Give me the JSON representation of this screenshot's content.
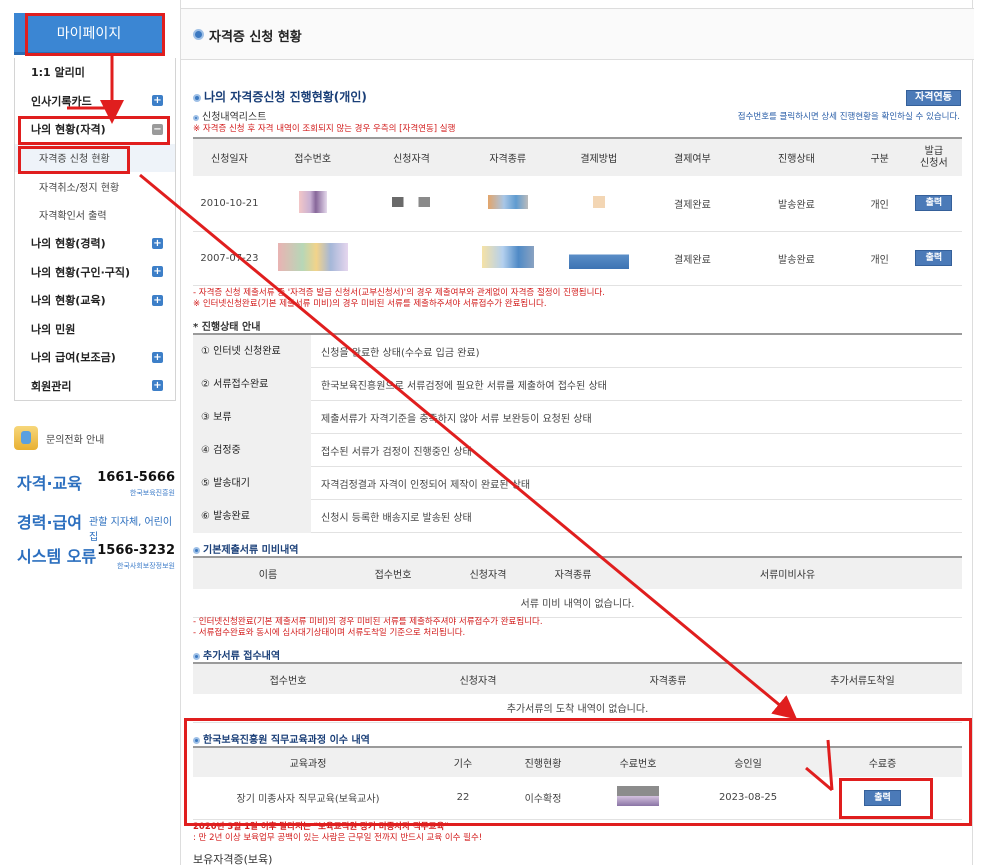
{
  "sidebar": {
    "mypage_label": "마이페이지",
    "items": [
      {
        "label": "1:1 알리미",
        "type": "top",
        "icon": ""
      },
      {
        "label": "인사기록카드",
        "type": "top",
        "icon": "plus"
      },
      {
        "label": "나의 현황(자격)",
        "type": "top",
        "icon": "minus"
      },
      {
        "label": "자격증 신청 현황",
        "type": "sub",
        "icon": ""
      },
      {
        "label": "자격취소/정지 현황",
        "type": "sub",
        "icon": ""
      },
      {
        "label": "자격확인서 출력",
        "type": "sub",
        "icon": ""
      },
      {
        "label": "나의 현황(경력)",
        "type": "top",
        "icon": "plus"
      },
      {
        "label": "나의 현황(구인·구직)",
        "type": "top",
        "icon": "plus"
      },
      {
        "label": "나의 현황(교육)",
        "type": "top",
        "icon": "plus"
      },
      {
        "label": "나의 민원",
        "type": "top",
        "icon": ""
      },
      {
        "label": "나의 급여(보조금)",
        "type": "top",
        "icon": "plus"
      },
      {
        "label": "회원관리",
        "type": "top",
        "icon": "plus"
      }
    ],
    "call_label": "문의전화 안내",
    "contacts": [
      {
        "label": "자격·교육",
        "number": "1661-5666",
        "org": "한국보육진흥원"
      },
      {
        "label": "경력·급여",
        "inline": "관할 지자체, 어린이집"
      },
      {
        "label": "시스템 오류",
        "number": "1566-3232",
        "org": "한국사회보장정보원"
      }
    ]
  },
  "header": {
    "title": "자격증 신청 현황"
  },
  "progress": {
    "title": "나의 자격증신청 진행현황(개인)",
    "link_button": "자격연동",
    "list_title": "신청내역리스트",
    "list_help": "접수번호를 클릭하시면 상세 진행현황을 확인하실 수 있습니다.",
    "warning": "※ 자격증 신청 후 자격 내역이 조회되지 않는 경우 우측의 [자격연동] 실행",
    "columns": [
      "신청일자",
      "접수번호",
      "신청자격",
      "자격종류",
      "결제방법",
      "결제여부",
      "진행상태",
      "구분",
      "발급\n신청서"
    ],
    "rows": [
      {
        "date": "2010-10-21",
        "paid": "결제완료",
        "state": "발송완료",
        "kind": "개인",
        "print": "출력"
      },
      {
        "date": "2007-07-23",
        "paid": "결제완료",
        "state": "발송완료",
        "kind": "개인",
        "print": "출력"
      }
    ],
    "notes": [
      "- 자격증 신청 제출서류 중 '자격증 발급 신청서(교부신청서)'의 경우 제출여부와 관계없이 자격증 절정이 진행됩니다.",
      "※ 인터넷신청완료(기본 제출서류 미비)의 경우 미비된 서류를 제출하주셔야 서류접수가 완료됩니다."
    ]
  },
  "status_guide": {
    "title": "* 진행상태 안내",
    "rows": [
      {
        "k": "① 인터넷 신청완료",
        "v": "신청을 완료한 상태(수수료 입금 완료)"
      },
      {
        "k": "② 서류접수완료",
        "v": "한국보육진흥원으로 서류검정에 필요한 서류를 제출하여 접수된 상태"
      },
      {
        "k": "③ 보류",
        "v": "제출서류가 자격기준을 충족하지 않아 서류 보완등이 요청된 상태"
      },
      {
        "k": "④ 검정중",
        "v": "접수된 서류가 검정이 진행중인 상태"
      },
      {
        "k": "⑤ 발송대기",
        "v": "자격검정결과 자격이 인정되어 제작이 완료된 상태"
      },
      {
        "k": "⑥ 발송완료",
        "v": "신청시 등록한 배송지로 발송된 상태"
      }
    ]
  },
  "missing_docs": {
    "title": "기본제출서류 미비내역",
    "columns": [
      "이름",
      "접수번호",
      "신청자격",
      "자격종류",
      "서류미비사유"
    ],
    "empty": "서류 미비 내역이 없습니다.",
    "notes": [
      "- 인터넷신청완료(기본 제출서류 미비)의 경우 미비된 서류를 제출하주셔야 서류접수가 완료됩니다.",
      "- 서류접수완료와 동시에 심사대기상태이며 서류도착일 기준으로 처리됩니다."
    ]
  },
  "extra_docs": {
    "title": "추가서류 접수내역",
    "columns": [
      "접수번호",
      "신청자격",
      "자격종류",
      "추가서류도착일"
    ],
    "empty": "추가서류의 도착 내역이 없습니다."
  },
  "training": {
    "title": "한국보육진흥원 직무교육과정 이수 내역",
    "columns": [
      "교육과정",
      "기수",
      "진행현황",
      "수료번호",
      "승인일",
      "수료증"
    ],
    "row": {
      "course": "장기 미종사자 직무교육(보육교사)",
      "term": "22",
      "status": "이수확정",
      "date": "2023-08-25",
      "print": "출력"
    },
    "note1": "2020년 3월 1일 이후 달라지는 \"보육교직원 장기 미종사자 직무교육\"",
    "note2": ": 만 2년 이상 보육업무 공백이 있는 사람은 근무일 전까지 반드시 교육 이수 필수!",
    "footer": "보유자격증(보육)"
  },
  "colors": {
    "accent": "#3b86d3",
    "button": "#4b7ab8",
    "annotation": "#e01e1e"
  }
}
